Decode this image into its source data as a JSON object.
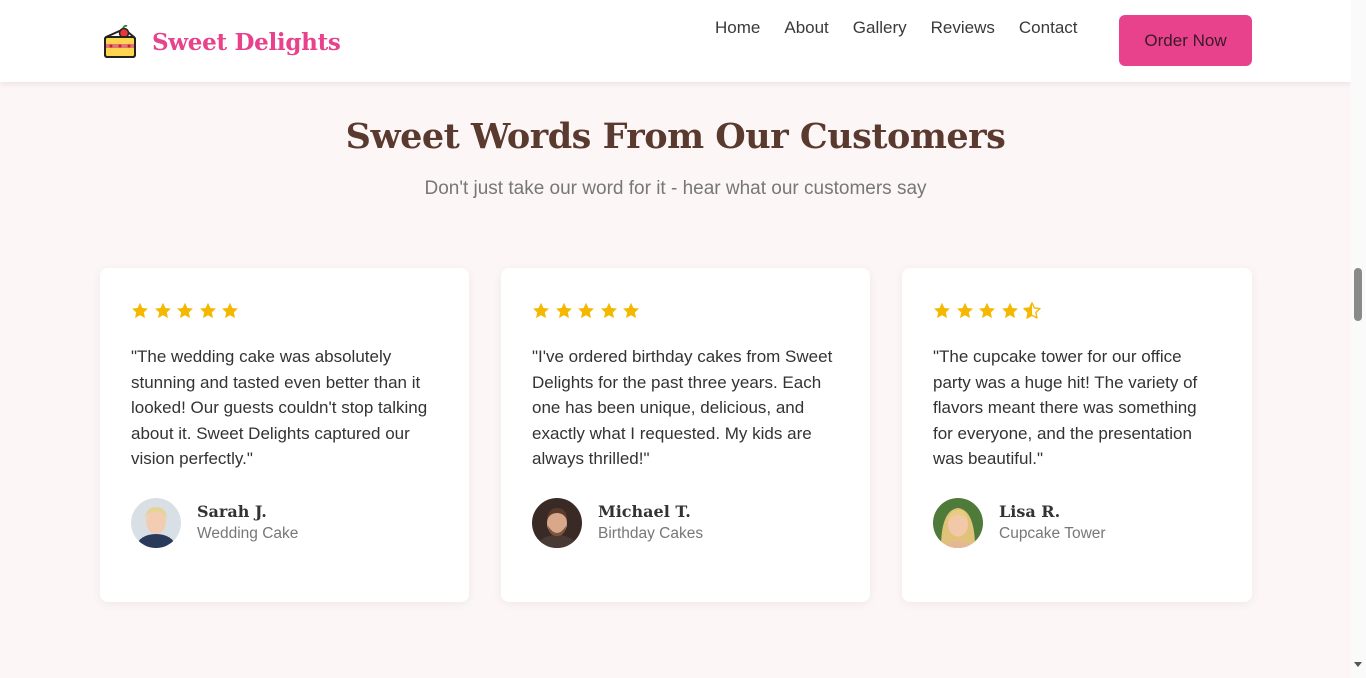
{
  "brand": {
    "name": "Sweet Delights",
    "icon": "cake-slice-icon",
    "color": "#e8428c"
  },
  "nav": {
    "items": [
      "Home",
      "About",
      "Gallery",
      "Reviews",
      "Contact"
    ],
    "cta": "Order Now"
  },
  "section": {
    "title": "Sweet Words From Our Customers",
    "subtitle": "Don't just take our word for it - hear what our customers say"
  },
  "reviews": [
    {
      "rating": 5,
      "text": "\"The wedding cake was absolutely stunning and tasted even better than it looked! Our guests couldn't stop talking about it. Sweet Delights captured our vision perfectly.\"",
      "name": "Sarah J.",
      "item": "Wedding Cake"
    },
    {
      "rating": 5,
      "text": "\"I've ordered birthday cakes from Sweet Delights for the past three years. Each one has been unique, delicious, and exactly what I requested. My kids are always thrilled!\"",
      "name": "Michael T.",
      "item": "Birthday Cakes"
    },
    {
      "rating": 4.5,
      "text": "\"The cupcake tower for our office party was a huge hit! The variety of flavors meant there was something for everyone, and the presentation was beautiful.\"",
      "name": "Lisa R.",
      "item": "Cupcake Tower"
    }
  ],
  "colors": {
    "star": "#f5b800",
    "accent": "#e8428c",
    "heading": "#5a3a2e",
    "background": "#fdf6f6"
  }
}
